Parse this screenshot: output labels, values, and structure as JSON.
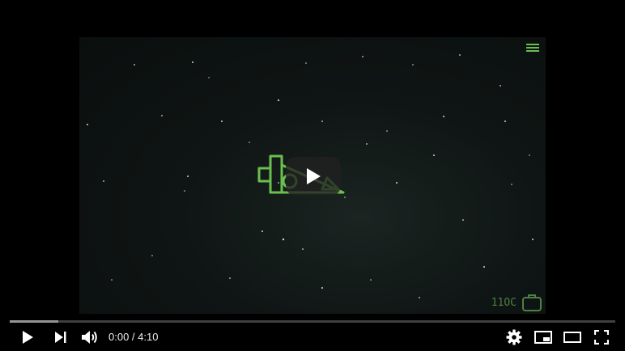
{
  "player": {
    "time_current": "0:00",
    "time_separator": " / ",
    "time_duration": "4:10",
    "progress_fraction": 0.0,
    "buffered_fraction": 0.08,
    "channel_watermark": "11OC"
  },
  "colors": {
    "logo_green": "#6bbf4e",
    "watermark_green": "#4e7f43",
    "progress_red": "#ff0000",
    "background": "#000000"
  },
  "icons": {
    "menu": "hamburger-menu-icon",
    "big_play": "play-icon",
    "play": "play-icon",
    "next": "skip-next-icon",
    "volume": "volume-icon",
    "settings": "gear-icon",
    "miniplayer": "miniplayer-icon",
    "theater": "theater-mode-icon",
    "fullscreen": "fullscreen-icon"
  }
}
